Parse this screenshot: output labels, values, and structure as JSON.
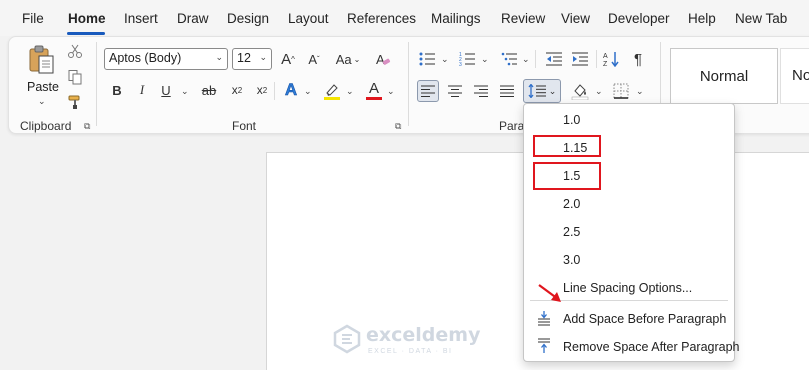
{
  "tabs": [
    "File",
    "Home",
    "Insert",
    "Draw",
    "Design",
    "Layout",
    "References",
    "Mailings",
    "Review",
    "View",
    "Developer",
    "Help",
    "New Tab"
  ],
  "active_tab": "Home",
  "ribbon": {
    "clipboard": {
      "label": "Clipboard",
      "paste_label": "Paste"
    },
    "font": {
      "label": "Font",
      "font_name": "Aptos (Body)",
      "font_size": "12"
    },
    "paragraph": {
      "label": "Paragraph"
    },
    "styles": {
      "normal": "Normal",
      "next_partial": "No"
    }
  },
  "line_spacing_menu": {
    "items": [
      "1.0",
      "1.15",
      "1.5",
      "2.0",
      "2.5",
      "3.0"
    ],
    "highlighted": [
      "1.15",
      "1.5"
    ],
    "options_label": "Line Spacing Options...",
    "add_space_label": "Add Space Before Paragraph",
    "remove_space_label": "Remove Space After Paragraph"
  },
  "watermark": {
    "title": "exceldemy",
    "subtitle": "EXCEL · DATA · BI"
  },
  "colors": {
    "accent": "#185abd",
    "highlight_box": "#e0161e",
    "font_color": "#e0161e",
    "highlight_color": "#f5e400",
    "arrow": "#e0161e"
  }
}
